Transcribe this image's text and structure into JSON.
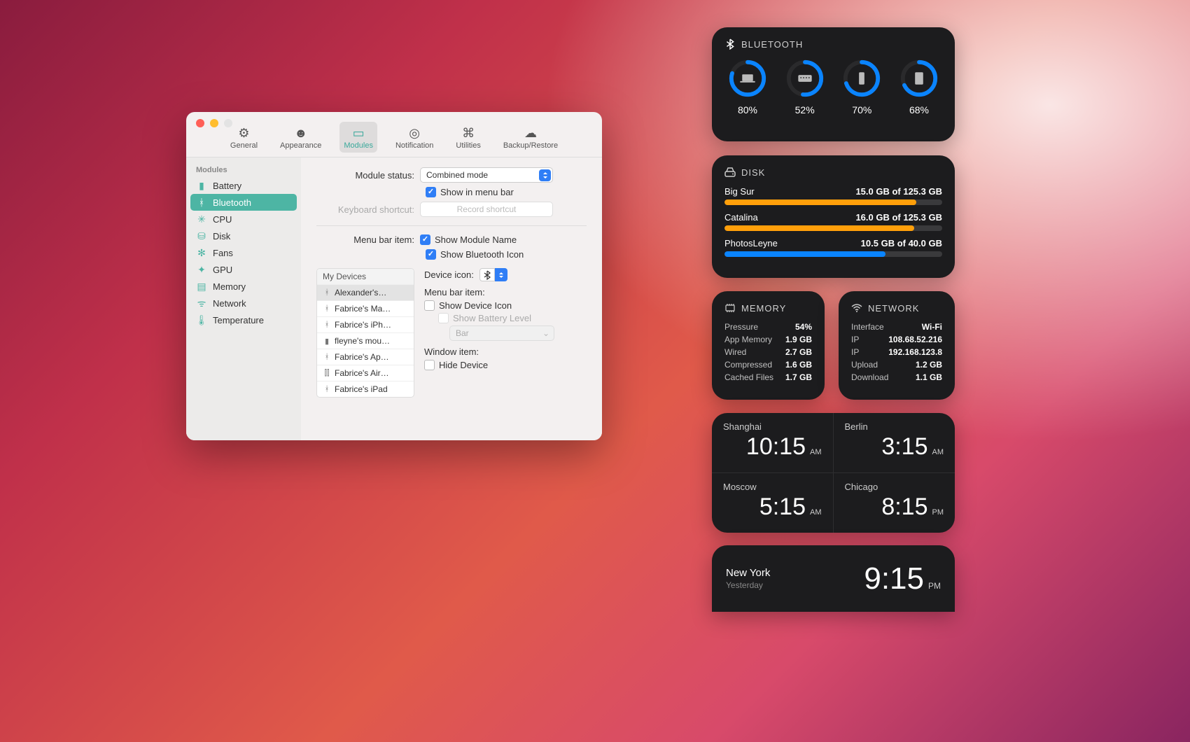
{
  "toolbar": {
    "general": "General",
    "appearance": "Appearance",
    "modules": "Modules",
    "notification": "Notification",
    "utilities": "Utilities",
    "backup": "Backup/Restore"
  },
  "sidebar": {
    "title": "Modules",
    "items": [
      "Battery",
      "Bluetooth",
      "CPU",
      "Disk",
      "Fans",
      "GPU",
      "Memory",
      "Network",
      "Temperature"
    ],
    "selected": "Bluetooth"
  },
  "form": {
    "module_status_label": "Module status:",
    "module_status_value": "Combined mode",
    "show_menu": "Show in menu bar",
    "kb_label": "Keyboard shortcut:",
    "kb_placeholder": "Record shortcut",
    "menubar_item_label": "Menu bar item:",
    "show_module_name": "Show Module Name",
    "show_bt_icon": "Show Bluetooth Icon",
    "device_icon_label": "Device icon:",
    "menubar_item2": "Menu bar item:",
    "show_device_icon": "Show Device Icon",
    "show_battery_level": "Show Battery Level",
    "bar": "Bar",
    "window_item": "Window item:",
    "hide_device": "Hide Device"
  },
  "devices": {
    "title": "My Devices",
    "items": [
      "Alexander's…",
      "Fabrice's Ma…",
      "Fabrice's iPh…",
      "fleyne's mou…",
      "Fabrice's Ap…",
      "Fabrice's Air…",
      "Fabrice's iPad"
    ]
  },
  "widgets": {
    "bluetooth": {
      "title": "BLUETOOTH",
      "items": [
        {
          "pct": 80,
          "icon": "laptop"
        },
        {
          "pct": 52,
          "icon": "keyboard"
        },
        {
          "pct": 70,
          "icon": "phone"
        },
        {
          "pct": 68,
          "icon": "tablet"
        }
      ]
    },
    "disk": {
      "title": "DISK",
      "rows": [
        {
          "name": "Big Sur",
          "text": "15.0 GB of 125.3 GB",
          "pct": 88,
          "color": "#ff9f0a"
        },
        {
          "name": "Catalina",
          "text": "16.0 GB of 125.3 GB",
          "pct": 87,
          "color": "#ff9f0a"
        },
        {
          "name": "PhotosLeyne",
          "text": "10.5 GB of 40.0 GB",
          "pct": 74,
          "color": "#0a84ff"
        }
      ]
    },
    "memory": {
      "title": "MEMORY",
      "rows": [
        {
          "k": "Pressure",
          "v": "54%"
        },
        {
          "k": "App Memory",
          "v": "1.9 GB"
        },
        {
          "k": "Wired",
          "v": "2.7 GB"
        },
        {
          "k": "Compressed",
          "v": "1.6 GB"
        },
        {
          "k": "Cached Files",
          "v": "1.7 GB"
        }
      ]
    },
    "network": {
      "title": "NETWORK",
      "rows": [
        {
          "k": "Interface",
          "v": "Wi-Fi"
        },
        {
          "k": "IP",
          "v": "108.68.52.216"
        },
        {
          "k": "IP",
          "v": "192.168.123.8"
        },
        {
          "k": "Upload",
          "v": "1.2 GB"
        },
        {
          "k": "Download",
          "v": "1.1 GB"
        }
      ]
    },
    "clocks": [
      {
        "city": "Shanghai",
        "time": "10:15",
        "ap": "AM"
      },
      {
        "city": "Berlin",
        "time": "3:15",
        "ap": "AM"
      },
      {
        "city": "Moscow",
        "time": "5:15",
        "ap": "AM"
      },
      {
        "city": "Chicago",
        "time": "8:15",
        "ap": "PM"
      }
    ],
    "ny": {
      "city": "New York",
      "sub": "Yesterday",
      "time": "9:15",
      "ap": "PM"
    }
  }
}
